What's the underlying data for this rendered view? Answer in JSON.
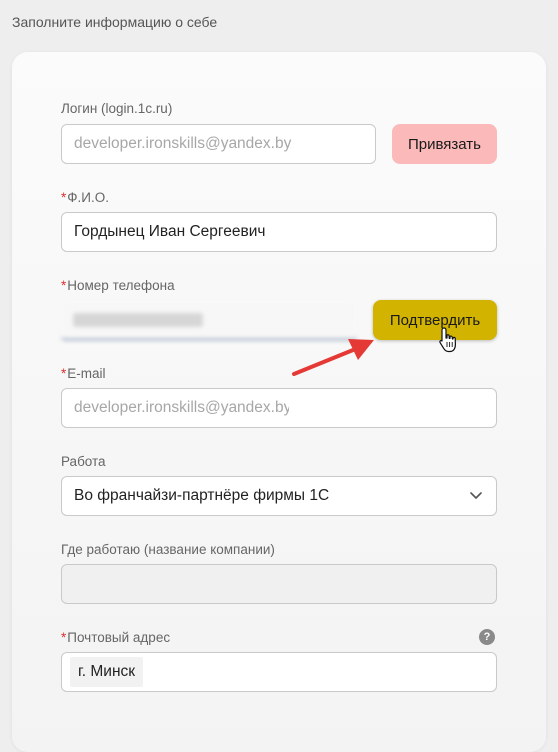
{
  "page": {
    "heading": "Заполните информацию о себе"
  },
  "form": {
    "login": {
      "label": "Логин (login.1c.ru)",
      "value": "developer.ironskills@yandex.by",
      "button_label": "Привязать"
    },
    "fio": {
      "required_mark": "*",
      "label": "Ф.И.О.",
      "value": "Гордынец Иван Сергеевич"
    },
    "phone": {
      "required_mark": "*",
      "label": "Номер телефона",
      "button_label": "Подтвердить"
    },
    "email": {
      "required_mark": "*",
      "label": "E-mail",
      "value": "developer.ironskills@yandex.by"
    },
    "work": {
      "label": "Работа",
      "selected": "Во франчайзи-партнёре фирмы 1С"
    },
    "company": {
      "label": "Где работаю (название компании)",
      "value": ""
    },
    "address": {
      "required_mark": "*",
      "label": "Почтовый адрес",
      "help_glyph": "?",
      "value": "г. Минск"
    }
  },
  "colors": {
    "link_button": "#fbb9b9",
    "confirm_button": "#d2b400",
    "required_mark": "#e03030",
    "annotation_arrow": "#e53935"
  },
  "icons": {
    "select": "chevron-down-icon",
    "help": "question-circle-icon",
    "annotation": "red-arrow-icon",
    "pointer": "hand-pointer-cursor-icon"
  }
}
